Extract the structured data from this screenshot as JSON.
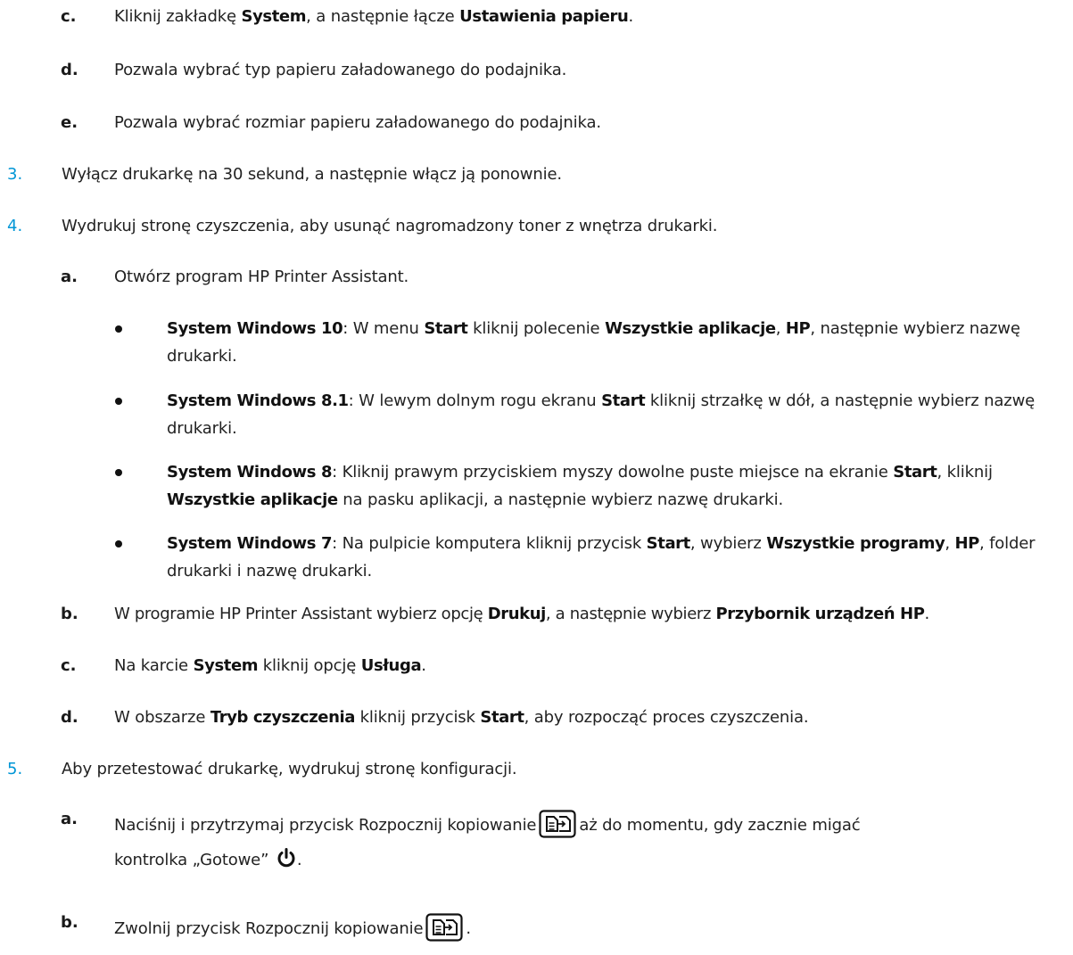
{
  "step_2": {
    "c": {
      "marker": "c.",
      "text_1": "Kliknij zakładkę ",
      "b_1": "System",
      "text_2": ", a następnie łącze ",
      "b_2": "Ustawienia papieru",
      "text_3": "."
    },
    "d": {
      "marker": "d.",
      "text": "Pozwala wybrać typ papieru załadowanego do podajnika."
    },
    "e": {
      "marker": "e.",
      "text": "Pozwala wybrać rozmiar papieru załadowanego do podajnika."
    }
  },
  "step_3": {
    "marker": "3.",
    "text": "Wyłącz drukarkę na 30 sekund, a następnie włącz ją ponownie."
  },
  "step_4": {
    "marker": "4.",
    "text": "Wydrukuj stronę czyszczenia, aby usunąć nagromadzony toner z wnętrza drukarki.",
    "a": {
      "marker": "a.",
      "text": "Otwórz program HP Printer Assistant."
    },
    "bullets": [
      {
        "b_1": "System Windows 10",
        "text_1": ": W menu ",
        "b_2": "Start",
        "text_2": " kliknij polecenie ",
        "b_3": "Wszystkie aplikacje",
        "text_3": ", ",
        "b_4": "HP",
        "text_4": ", następnie wybierz nazwę drukarki."
      },
      {
        "b_1": "System Windows 8.1",
        "text_1": ": W lewym dolnym rogu ekranu ",
        "b_2": "Start",
        "text_2": " kliknij strzałkę w dół, a następnie wybierz nazwę drukarki."
      },
      {
        "b_1": "System Windows 8",
        "text_1": ": Kliknij prawym przyciskiem myszy dowolne puste miejsce na ekranie ",
        "b_2": "Start",
        "text_2": ", kliknij ",
        "b_3": "Wszystkie aplikacje",
        "text_3": " na pasku aplikacji, a następnie wybierz nazwę drukarki."
      },
      {
        "b_1": "System Windows 7",
        "text_1": ": Na pulpicie komputera kliknij przycisk ",
        "b_2": "Start",
        "text_2": ", wybierz ",
        "b_3": "Wszystkie programy",
        "text_3": ", ",
        "b_4": "HP",
        "text_4": ", folder drukarki i nazwę drukarki."
      }
    ],
    "b": {
      "marker": "b.",
      "text_1": "W programie HP Printer Assistant wybierz opcję ",
      "b_1": "Drukuj",
      "text_2": ", a następnie wybierz ",
      "b_2": "Przybornik urządzeń HP",
      "text_3": "."
    },
    "c": {
      "marker": "c.",
      "text_1": "Na karcie ",
      "b_1": "System",
      "text_2": " kliknij opcję ",
      "b_2": "Usługa",
      "text_3": "."
    },
    "d": {
      "marker": "d.",
      "text_1": "W obszarze ",
      "b_1": "Tryb czyszczenia",
      "text_2": " kliknij przycisk ",
      "b_2": "Start",
      "text_3": ", aby rozpocząć proces czyszczenia."
    }
  },
  "step_5": {
    "marker": "5.",
    "text": "Aby przetestować drukarkę, wydrukuj stronę konfiguracji.",
    "a": {
      "marker": "a.",
      "text_1": "Naciśnij i przytrzymaj przycisk Rozpocznij kopiowanie",
      "text_2": "aż do momentu, gdy zacznie migać",
      "text_3": "kontrolka „Gotowe”",
      "text_4": "."
    },
    "b": {
      "marker": "b.",
      "text_1": "Zwolnij przycisk Rozpocznij kopiowanie",
      "text_2": "."
    }
  },
  "colors": {
    "step_number": "#0096d6",
    "text": "#222222"
  },
  "icons": [
    "copy-start-button-icon",
    "power-ready-icon"
  ]
}
